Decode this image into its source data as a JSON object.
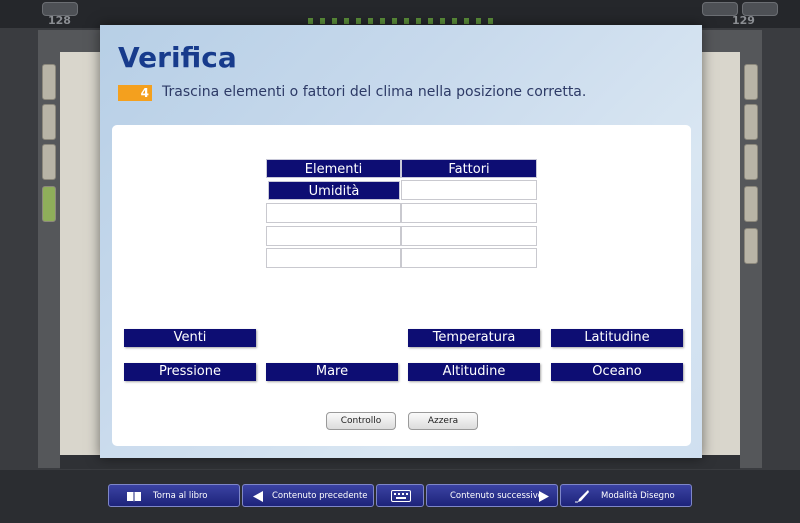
{
  "topbar": {
    "page_left": "128",
    "page_right": "129"
  },
  "book": {
    "spine_label": "Verifica"
  },
  "modal": {
    "title": "Verifica",
    "question_number": "4",
    "question_text": "Trascina elementi o fattori del clima nella posizione corretta."
  },
  "table": {
    "headers": [
      "Elementi",
      "Fattori"
    ],
    "placed": {
      "elementi": [
        "Umidità"
      ],
      "fattori": []
    }
  },
  "chips": {
    "row1": [
      "Venti",
      "Temperatura",
      "Latitudine"
    ],
    "row2": [
      "Pressione",
      "Mare",
      "Altitudine",
      "Oceano"
    ]
  },
  "buttons": {
    "check": "Controllo",
    "reset": "Azzera"
  },
  "toolbar": {
    "back_to_book": "Torna al libro",
    "prev": "Contenuto precedente",
    "next": "Contenuto successivo",
    "draw": "Modalità Disegno"
  },
  "colors": {
    "accent": "#0d0d73",
    "title": "#173b8c",
    "badge": "#f4a01e"
  },
  "icons": [
    "book-icon",
    "prev-arrow-icon",
    "keyboard-icon",
    "next-arrow-icon",
    "pen-icon"
  ]
}
